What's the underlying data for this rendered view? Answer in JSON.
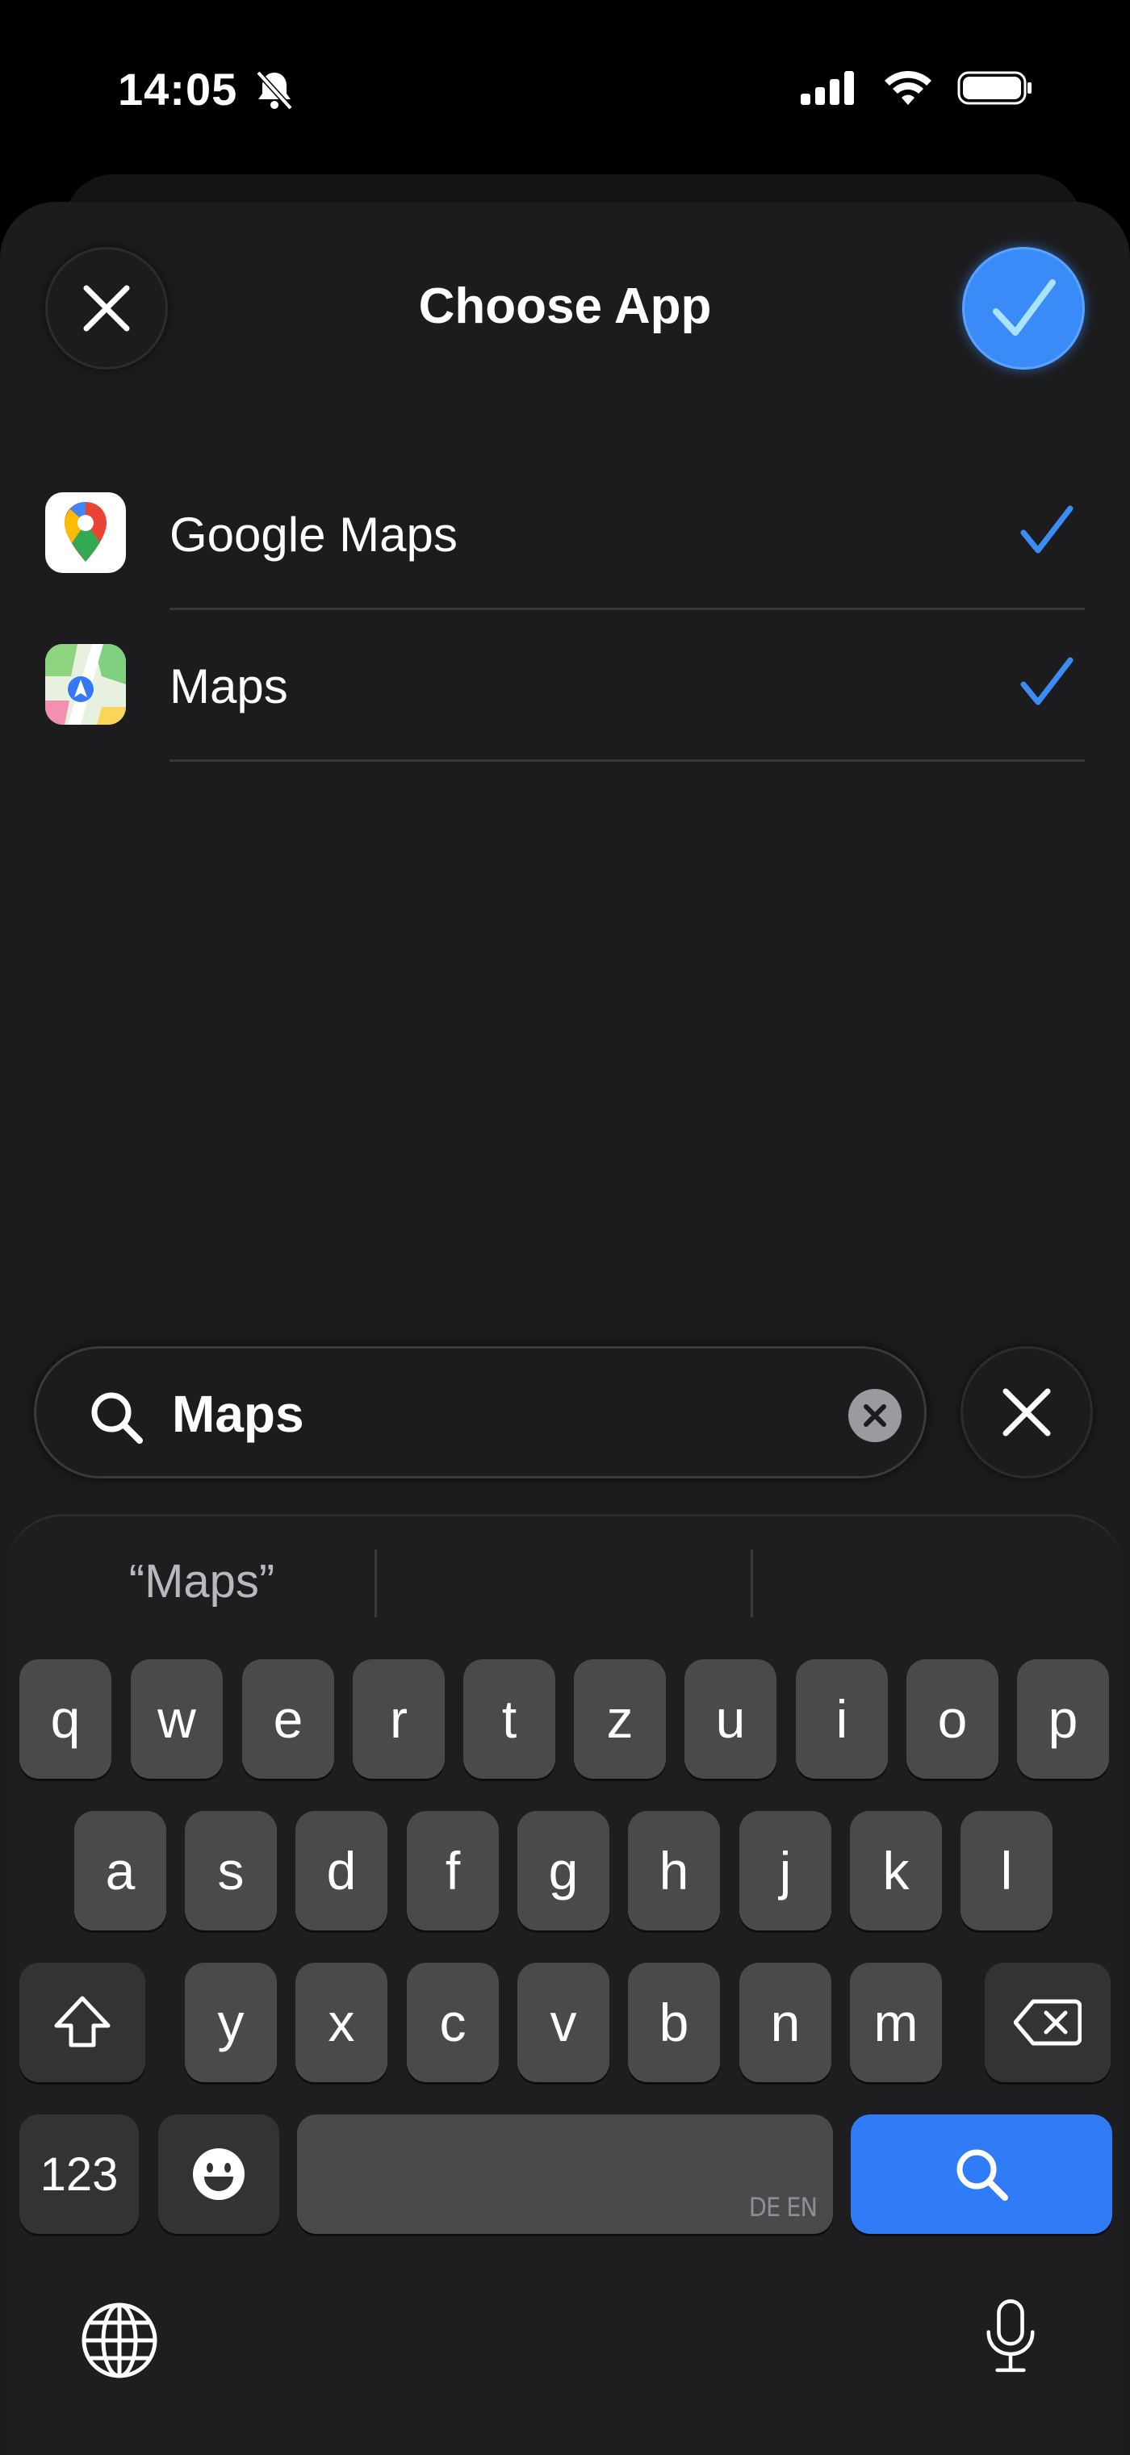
{
  "status_bar": {
    "time": "14:05"
  },
  "header": {
    "title": "Choose App"
  },
  "apps": [
    {
      "name": "Google Maps",
      "checked": true
    },
    {
      "name": "Maps",
      "checked": true
    }
  ],
  "search": {
    "value": "Maps"
  },
  "keyboard": {
    "suggestions": [
      "“Maps”",
      "",
      ""
    ],
    "row1": [
      "q",
      "w",
      "e",
      "r",
      "t",
      "z",
      "u",
      "i",
      "o",
      "p"
    ],
    "row2": [
      "a",
      "s",
      "d",
      "f",
      "g",
      "h",
      "j",
      "k",
      "l"
    ],
    "row3": [
      "y",
      "x",
      "c",
      "v",
      "b",
      "n",
      "m"
    ],
    "numbers_label": "123",
    "space_languages": "DE EN"
  },
  "colors": {
    "accent": "#3a8bf7",
    "checkmark": "#3b8cf5",
    "background": "#1c1c1e"
  }
}
